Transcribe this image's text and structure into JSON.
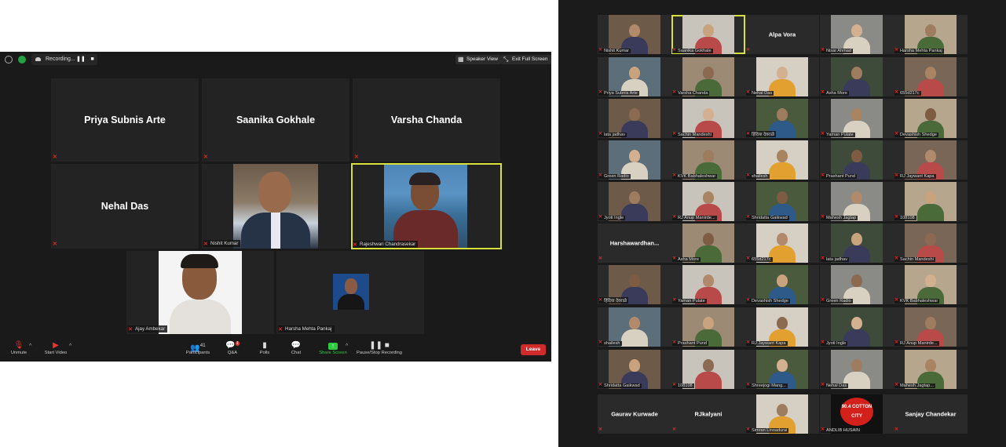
{
  "left_window": {
    "recording_label": "Recording...",
    "speaker_view_label": "Speaker View",
    "exit_fullscreen_label": "Exit Full Screen",
    "tiles": [
      {
        "name": "Priya Subnis Arte",
        "type": "text"
      },
      {
        "name": "Saanika Gokhale",
        "type": "text"
      },
      {
        "name": "Varsha Chanda",
        "type": "text"
      },
      {
        "name": "Nehal Das",
        "type": "text"
      },
      {
        "label": "Nishit Kumar",
        "type": "video"
      },
      {
        "label": "Rajeshwari Chandrasekar",
        "type": "video",
        "active_speaker": true
      },
      {
        "label": "Ajay Ambekar",
        "type": "video"
      },
      {
        "label": "Harsha Mehta Pankaj",
        "type": "video"
      }
    ],
    "toolbar": {
      "unmute": "Unmute",
      "start_video": "Start Video",
      "participants": "Participants",
      "participants_count": "41",
      "qa": "Q&A",
      "qa_badge": "1",
      "polls": "Polls",
      "chat": "Chat",
      "share_screen": "Share Screen",
      "pause_recording": "Pause/Stop Recording",
      "leave": "Leave"
    },
    "colors": {
      "share_green": "#2ecc40",
      "leave_red": "#d12a2a",
      "active_speaker_border": "#d9e03a"
    }
  },
  "right_window": {
    "tiles": [
      [
        "Nishit Kumar",
        "Saanika Gokhale",
        "Alpa Vora",
        "Nisar Ahmad",
        "Harsha Mehta Pankaj"
      ],
      [
        "Priya Subnis Arte",
        "Varsha Chanda",
        "Nehal Das",
        "Asha More",
        "655d217c"
      ],
      [
        "lata jadhav",
        "Sachin Mandeshi",
        "हिंदिया देवराळे",
        "Yaman Pulate",
        "Devashish Shedge"
      ],
      [
        "Green Radio",
        "KVK Babhaleshwar",
        "shailesh",
        "Prashant Pund",
        "RJ Jaywant Kapa"
      ],
      [
        "Jyoti Ingle",
        "RJ Anup Manirde...",
        "Shridatta Gaikwad",
        "Mahesh Jagtap",
        "108108"
      ],
      [
        "Harshawardhan...",
        "Asha More",
        "655d217c",
        "lata jadhav",
        "Sachin Mandeshi"
      ],
      [
        "हिंदिया देवराळे",
        "Yaman Pulate",
        "Devashish Shedge",
        "Green Radio",
        "KVK Babhaleshwar"
      ],
      [
        "shailesh",
        "Prashant Pund",
        "RJ Jaywant Kapa",
        "Jyoti Ingle",
        "RJ Anup Manirde..."
      ],
      [
        "Shridatta Gaikwad",
        "108108",
        "Shreejogi Mang...",
        "Nehal Das",
        "Mahesh Jagtap..."
      ],
      [
        "Gaurav Kurwade",
        "RJkalyani",
        "Simran Linoadurai",
        "ANDLIB HUSAIN",
        "Sanjay Chandekar"
      ]
    ],
    "text_only": [
      "Alpa Vora",
      "Harshawardhan...",
      "Gaurav Kurwade",
      "RJkalyani",
      "Sanjay Chandekar"
    ],
    "highlighted": "Saanika Gokhale",
    "logo_text": "90.4 COTTON CITY"
  }
}
